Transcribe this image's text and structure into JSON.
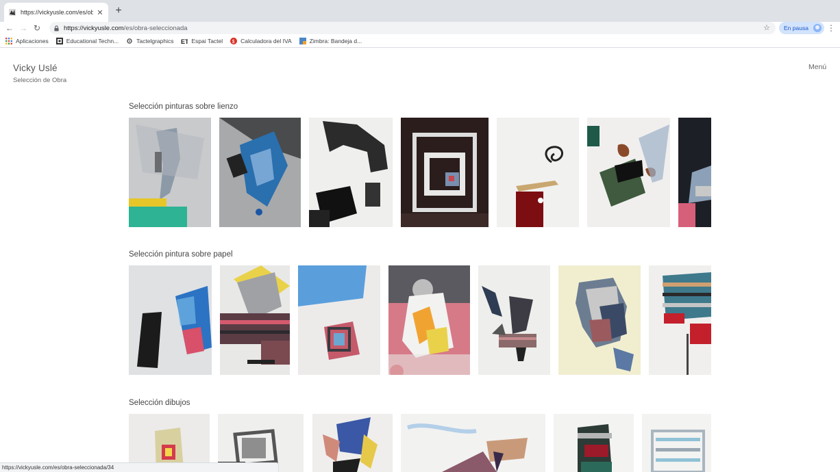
{
  "browser": {
    "tab_title": "https://vickyusle.com/es/obra-",
    "url_host": "https://vickyusle.com",
    "url_path": "/es/obra-seleccionada",
    "profile_label": "En pausa",
    "status_url": "https://vickyusle.com/es/obra-seleccionada/34"
  },
  "bookmarks": [
    {
      "label": "Aplicaciones",
      "icon": "apps-grid-icon"
    },
    {
      "label": "Educational Techn...",
      "icon": "educational-tech-icon"
    },
    {
      "label": "Tactelgraphics",
      "icon": "tactelgraphics-icon"
    },
    {
      "label": "Espai Tactel",
      "icon": "espai-tactel-icon"
    },
    {
      "label": "Calculadora del IVA",
      "icon": "iva-calculator-icon"
    },
    {
      "label": "Zimbra: Bandeja d...",
      "icon": "zimbra-icon"
    }
  ],
  "site": {
    "title": "Vicky Uslé",
    "subtitle": "Selección de Obra",
    "menu_label": "Menú"
  },
  "sections": [
    {
      "title": "Selección pinturas sobre lienzo"
    },
    {
      "title": "Selección pintura sobre papel"
    },
    {
      "title": "Selección dibujos"
    }
  ],
  "colors": {
    "tab_strip": "#dee1e6",
    "omnibox": "#f1f3f4",
    "profile_chip": "#d2e3fc",
    "text_muted": "#555555"
  }
}
